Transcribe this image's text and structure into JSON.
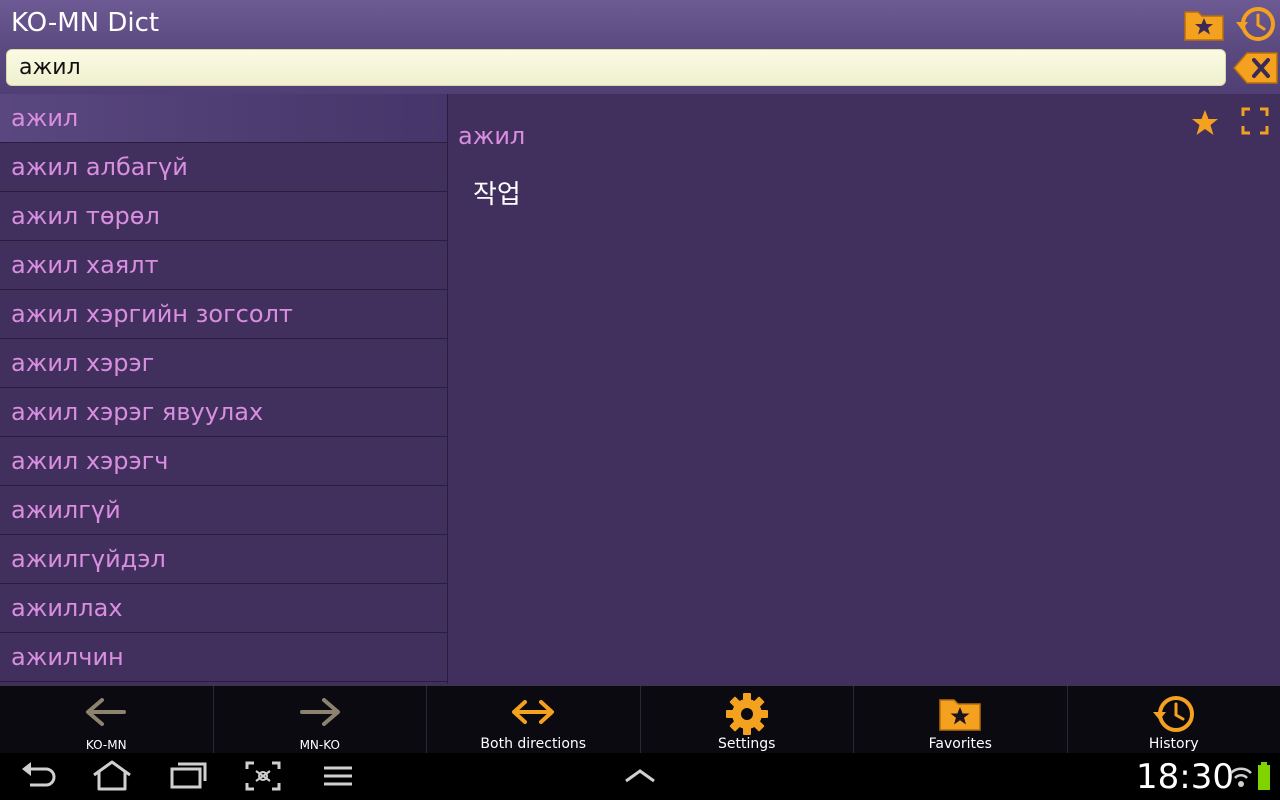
{
  "app": {
    "title": "KO-MN Dict"
  },
  "search": {
    "value": "ажил"
  },
  "word_list": [
    "ажил",
    "ажил албагүй",
    "ажил төрөл",
    "ажил хаялт",
    "ажил хэргийн зогсолт",
    "ажил хэрэг",
    "ажил хэрэг явуулах",
    "ажил хэрэгч",
    "ажилгүй",
    "ажилгүйдэл",
    "ажиллах",
    "ажилчин"
  ],
  "selected_index": 0,
  "definition": {
    "word": "ажил",
    "translation": "작업"
  },
  "bottom_bar": {
    "ko_mn": "KO-MN",
    "mn_ko": "MN-KO",
    "both": "Both directions",
    "settings": "Settings",
    "favorites": "Favorites",
    "history": "History"
  },
  "status": {
    "time": "18:30"
  },
  "colors": {
    "accent": "#f4a11f",
    "word": "#da8ee0",
    "background": "#41305e"
  }
}
